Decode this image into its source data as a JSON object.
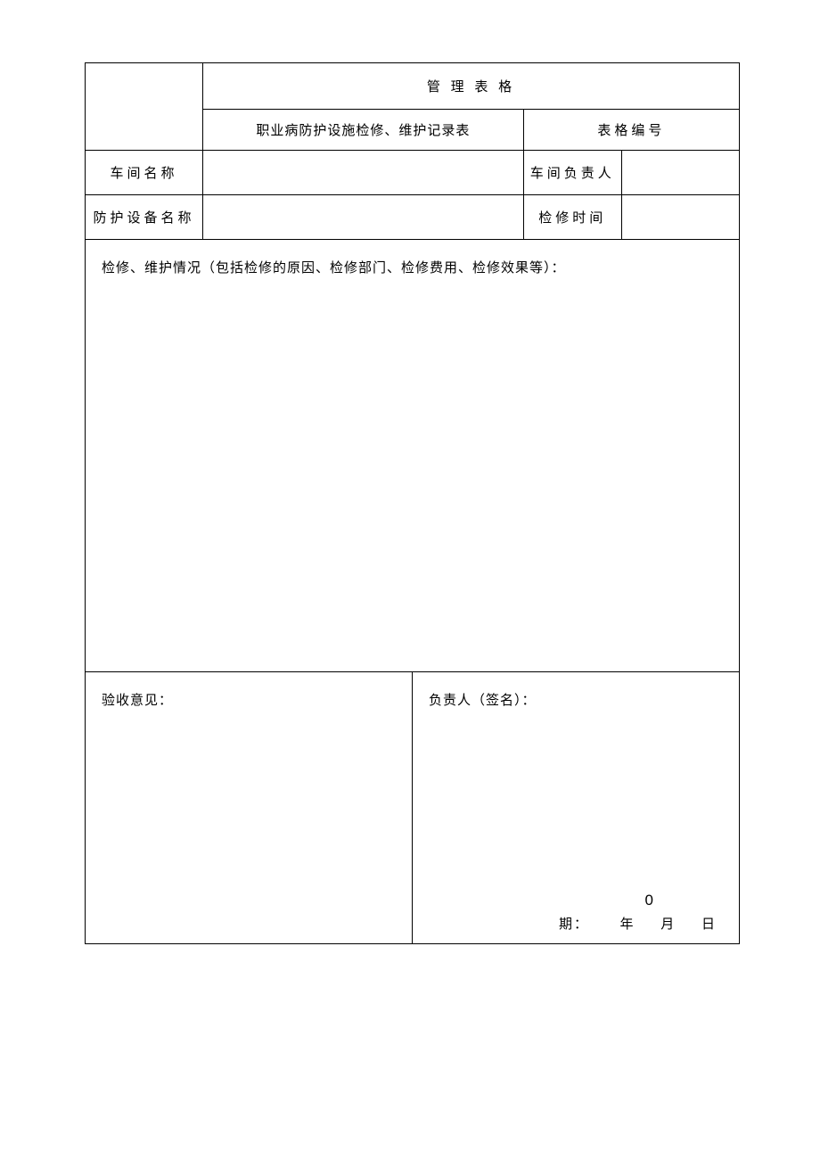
{
  "header": {
    "title": "管 理 表 格",
    "subtitle": "职业病防护设施检修、维护记录表",
    "form_number_label": "表格编号"
  },
  "fields": {
    "workshop_name_label": "车间名称",
    "workshop_leader_label": "车间负责人",
    "equipment_name_label": "防护设备名称",
    "repair_time_label": "检修时间"
  },
  "sections": {
    "repair_details_label": "检修、维护情况（包括检修的原因、检修部门、检修费用、检修效果等）：",
    "acceptance_label": "验收意见：",
    "signer_label": "负责人（签名）：",
    "date_prefix": "期：",
    "year": "年",
    "month": "月",
    "day": "日",
    "zero": "0"
  }
}
